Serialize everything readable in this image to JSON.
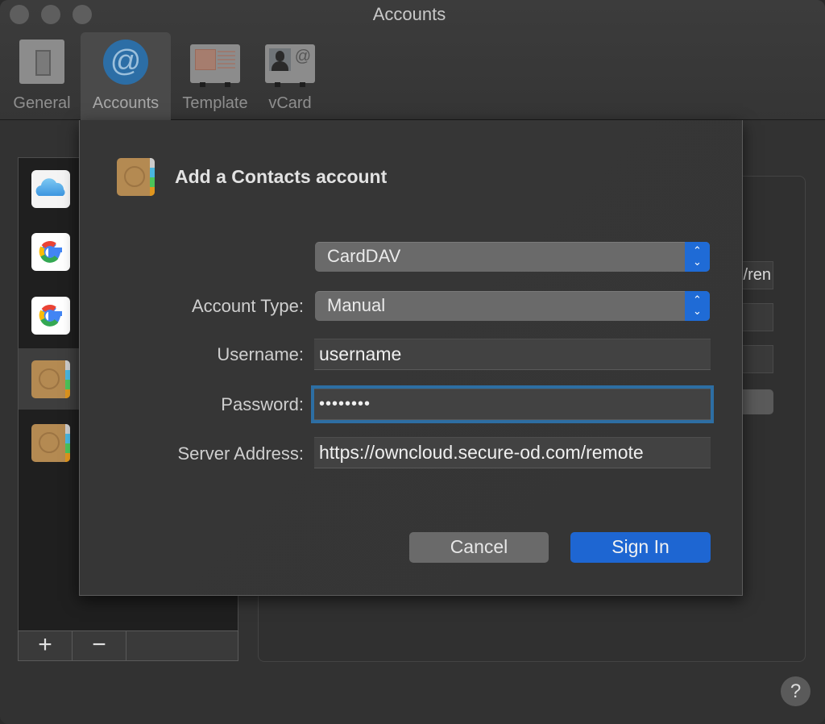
{
  "window": {
    "title": "Accounts"
  },
  "toolbar": {
    "items": [
      {
        "label": "General",
        "icon": "switch-icon"
      },
      {
        "label": "Accounts",
        "icon": "at-sign-icon",
        "active": true
      },
      {
        "label": "Template",
        "icon": "template-card-icon"
      },
      {
        "label": "vCard",
        "icon": "vcard-icon"
      }
    ]
  },
  "accounts_list": {
    "items": [
      {
        "type": "iCloud",
        "icon": "icloud-icon"
      },
      {
        "type": "Google",
        "icon": "google-icon"
      },
      {
        "type": "Google",
        "icon": "google-icon"
      },
      {
        "type": "CardDAV",
        "icon": "contacts-book-icon",
        "selected": true
      },
      {
        "type": "CardDAV",
        "icon": "contacts-book-icon"
      }
    ],
    "add_label": "+",
    "remove_label": "−"
  },
  "background_details": {
    "server_fragment": "/ren"
  },
  "help_label": "?",
  "dialog": {
    "title": "Add a Contacts account",
    "provider_select": {
      "value": "CardDAV"
    },
    "account_type": {
      "label": "Account Type:",
      "value": "Manual"
    },
    "username": {
      "label": "Username:",
      "value": "username"
    },
    "password": {
      "label": "Password:",
      "value": "••••••••"
    },
    "server_address": {
      "label": "Server Address:",
      "value": "https://owncloud.secure-od.com/remote"
    },
    "cancel_label": "Cancel",
    "sign_in_label": "Sign In"
  },
  "colors": {
    "accent": "#1e66d2",
    "focus_ring": "#2d6ea3",
    "window_bg": "#323232"
  }
}
